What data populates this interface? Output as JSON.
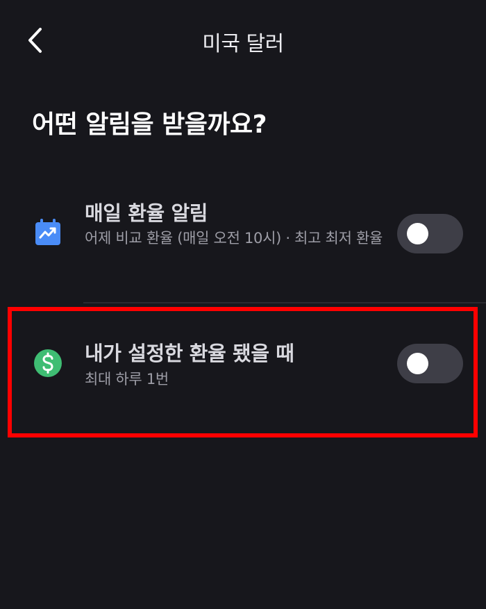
{
  "header": {
    "back_icon": "chevron-left-icon",
    "title": "미국 달러"
  },
  "question": "어떤 알림을 받을까요?",
  "options": [
    {
      "icon": "calendar-chart-icon",
      "icon_color": "#4a8cf7",
      "title": "매일 환율 알림",
      "description": "어제 비교 환율 (매일 오전 10시) · 최고 최저 환율",
      "toggle_on": false
    },
    {
      "icon": "dollar-circle-icon",
      "icon_color": "#3fbd73",
      "title": "내가 설정한 환율 됐을 때",
      "description": "최대 하루 1번",
      "toggle_on": false
    }
  ],
  "colors": {
    "background": "#17171c",
    "toggle_off": "#3e3e47",
    "highlight": "#ff0000"
  }
}
